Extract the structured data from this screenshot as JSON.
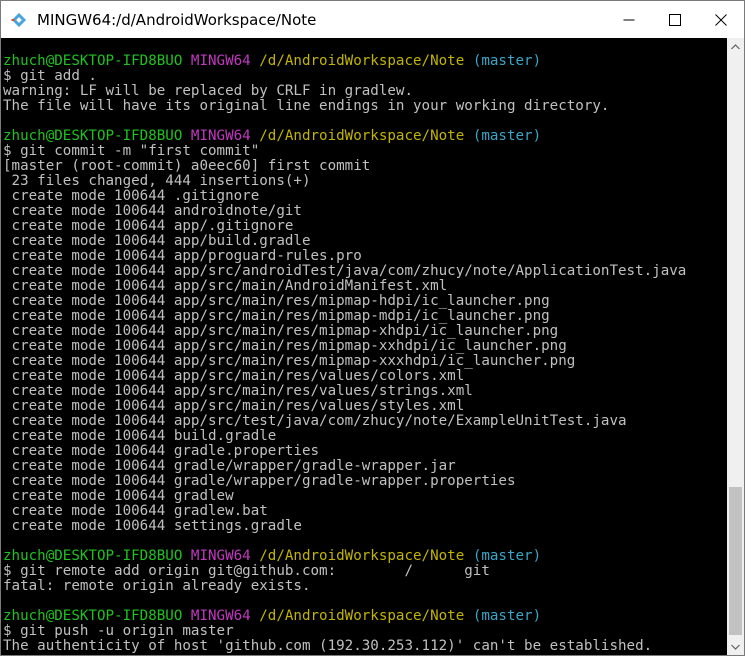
{
  "window": {
    "title": "MINGW64:/d/AndroidWorkspace/Note",
    "app_icon": "git-bash-diamond-icon",
    "controls": [
      "minimize-icon",
      "maximize-icon",
      "close-icon"
    ]
  },
  "colors": {
    "background": "#000000",
    "text": "#c0c0c0",
    "user_host": "#1fc31f",
    "shell": "#c238c2",
    "path": "#c1b400",
    "branch": "#3aa6c8",
    "icon": "#4aa4dc"
  },
  "terminal": {
    "lines": [
      {
        "type": "prompt",
        "user": "zhuch@DESKTOP-IFD8BUO",
        "shell": "MINGW64",
        "path": "/d/AndroidWorkspace/Note",
        "branch": "(master)"
      },
      {
        "type": "text",
        "text": "$ git add ."
      },
      {
        "type": "text",
        "text": "warning: LF will be replaced by CRLF in gradlew."
      },
      {
        "type": "text",
        "text": "The file will have its original line endings in your working directory."
      },
      {
        "type": "text",
        "text": ""
      },
      {
        "type": "prompt",
        "user": "zhuch@DESKTOP-IFD8BUO",
        "shell": "MINGW64",
        "path": "/d/AndroidWorkspace/Note",
        "branch": "(master)"
      },
      {
        "type": "text",
        "text": "$ git commit -m \"first commit\""
      },
      {
        "type": "text",
        "text": "[master (root-commit) a0eec60] first commit"
      },
      {
        "type": "text",
        "text": " 23 files changed, 444 insertions(+)"
      },
      {
        "type": "text",
        "text": " create mode 100644 .gitignore"
      },
      {
        "type": "text",
        "text": " create mode 100644 androidnote/git"
      },
      {
        "type": "text",
        "text": " create mode 100644 app/.gitignore"
      },
      {
        "type": "text",
        "text": " create mode 100644 app/build.gradle"
      },
      {
        "type": "text",
        "text": " create mode 100644 app/proguard-rules.pro"
      },
      {
        "type": "text",
        "text": " create mode 100644 app/src/androidTest/java/com/zhucy/note/ApplicationTest.java"
      },
      {
        "type": "text",
        "text": " create mode 100644 app/src/main/AndroidManifest.xml"
      },
      {
        "type": "text",
        "text": " create mode 100644 app/src/main/res/mipmap-hdpi/ic_launcher.png"
      },
      {
        "type": "text",
        "text": " create mode 100644 app/src/main/res/mipmap-mdpi/ic_launcher.png"
      },
      {
        "type": "text",
        "text": " create mode 100644 app/src/main/res/mipmap-xhdpi/ic_launcher.png"
      },
      {
        "type": "text",
        "text": " create mode 100644 app/src/main/res/mipmap-xxhdpi/ic_launcher.png"
      },
      {
        "type": "text",
        "text": " create mode 100644 app/src/main/res/mipmap-xxxhdpi/ic_launcher.png"
      },
      {
        "type": "text",
        "text": " create mode 100644 app/src/main/res/values/colors.xml"
      },
      {
        "type": "text",
        "text": " create mode 100644 app/src/main/res/values/strings.xml"
      },
      {
        "type": "text",
        "text": " create mode 100644 app/src/main/res/values/styles.xml"
      },
      {
        "type": "text",
        "text": " create mode 100644 app/src/test/java/com/zhucy/note/ExampleUnitTest.java"
      },
      {
        "type": "text",
        "text": " create mode 100644 build.gradle"
      },
      {
        "type": "text",
        "text": " create mode 100644 gradle.properties"
      },
      {
        "type": "text",
        "text": " create mode 100644 gradle/wrapper/gradle-wrapper.jar"
      },
      {
        "type": "text",
        "text": " create mode 100644 gradle/wrapper/gradle-wrapper.properties"
      },
      {
        "type": "text",
        "text": " create mode 100644 gradlew"
      },
      {
        "type": "text",
        "text": " create mode 100644 gradlew.bat"
      },
      {
        "type": "text",
        "text": " create mode 100644 settings.gradle"
      },
      {
        "type": "text",
        "text": ""
      },
      {
        "type": "prompt",
        "user": "zhuch@DESKTOP-IFD8BUO",
        "shell": "MINGW64",
        "path": "/d/AndroidWorkspace/Note",
        "branch": "(master)"
      },
      {
        "type": "text",
        "text": "$ git remote add origin git@github.com:        /      git"
      },
      {
        "type": "text",
        "text": "fatal: remote origin already exists."
      },
      {
        "type": "text",
        "text": ""
      },
      {
        "type": "prompt",
        "user": "zhuch@DESKTOP-IFD8BUO",
        "shell": "MINGW64",
        "path": "/d/AndroidWorkspace/Note",
        "branch": "(master)"
      },
      {
        "type": "text",
        "text": "$ git push -u origin master"
      },
      {
        "type": "text",
        "text": "The authenticity of host 'github.com (192.30.253.112)' can't be established."
      }
    ]
  }
}
